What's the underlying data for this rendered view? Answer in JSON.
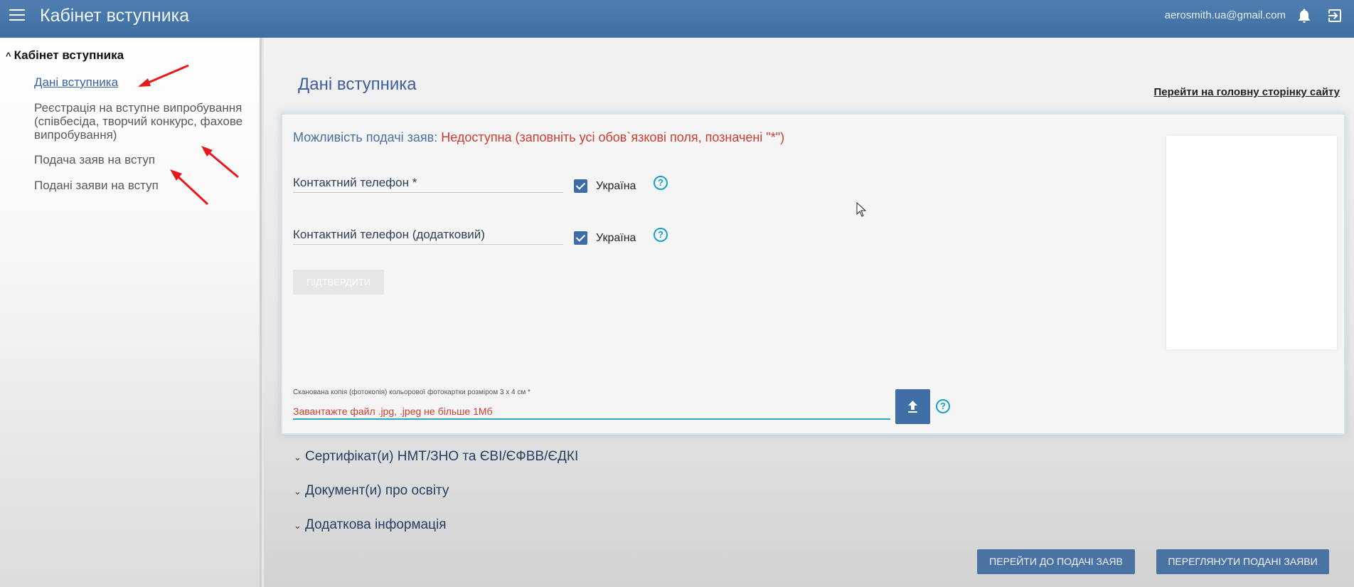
{
  "header": {
    "title": "Кабінет вступника",
    "user_email": "aerosmith.ua@gmail.com"
  },
  "sidebar": {
    "section_title": "Кабінет вступника",
    "items": [
      {
        "label": "Дані вступника"
      },
      {
        "label": "Реєстрація на вступне випробування (співбесіда, творчий конкурс, фахове випробування)"
      },
      {
        "label": "Подача заяв на вступ"
      },
      {
        "label": "Подані заяви на вступ"
      }
    ]
  },
  "main": {
    "page_title": "Дані вступника",
    "home_link": "Перейти на головну сторінку сайту",
    "availability_label": "Можливість подачі заяв:",
    "availability_value": "Недоступна (заповніть усі обов`язкові поля, позначені \"*\")",
    "phone_primary": {
      "placeholder": "Контактний телефон *",
      "country": "Україна"
    },
    "phone_secondary": {
      "placeholder": "Контактний телефон (додатковий)",
      "country": "Україна"
    },
    "confirm_button": "ПІДТВЕРДИТИ",
    "photo_upload": {
      "label": "Сканована копія (фотокопія) кольорової фотокартки розміром 3 х 4 см *",
      "hint": "Завантажте файл .jpg, .jpeg не більше 1Мб"
    },
    "sections": [
      {
        "label": "Сертифікат(и) НМТ/ЗНО та ЄВІ/ЄФВВ/ЄДКІ"
      },
      {
        "label": "Документ(и) про освіту"
      },
      {
        "label": "Додаткова інформація"
      }
    ],
    "buttons": {
      "go_to_applications": "ПЕРЕЙТИ ДО ПОДАЧІ ЗАЯВ",
      "view_applications": "ПЕРЕГЛЯНУТИ ПОДАНІ ЗАЯВИ"
    }
  },
  "colors": {
    "header": "#4a78a9",
    "accent": "#3f6fa6",
    "error": "#d23c2e",
    "help": "#17a2c6"
  },
  "icons": [
    "menu-icon",
    "bell-icon",
    "exit-icon",
    "help-icon",
    "upload-icon",
    "chevron-down-icon",
    "chevron-up-icon"
  ]
}
